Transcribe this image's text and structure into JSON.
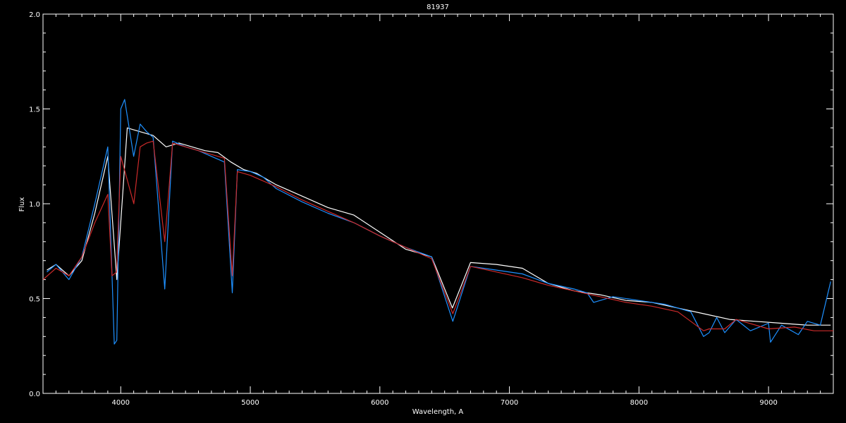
{
  "chart_data": {
    "type": "line",
    "title": "81937",
    "xlabel": "Wavelength, A",
    "ylabel": "Flux",
    "xlim": [
      3400,
      9500
    ],
    "ylim": [
      0.0,
      2.0
    ],
    "x_ticks": [
      4000,
      5000,
      6000,
      7000,
      8000,
      9000
    ],
    "x_tick_labels": [
      "4000",
      "5000",
      "6000",
      "7000",
      "8000",
      "9000"
    ],
    "y_ticks": [
      0.0,
      0.5,
      1.0,
      1.5,
      2.0
    ],
    "y_tick_labels": [
      "0.0",
      "0.5",
      "1.0",
      "1.5",
      "2.0"
    ],
    "grid": false,
    "series": [
      {
        "color": "#ffffff",
        "x": [
          3430,
          3500,
          3600,
          3700,
          3800,
          3900,
          3970,
          4050,
          4150,
          4250,
          4350,
          4450,
          4550,
          4650,
          4750,
          4850,
          4950,
          5050,
          5200,
          5400,
          5600,
          5800,
          6000,
          6200,
          6400,
          6560,
          6700,
          6900,
          7100,
          7300,
          7500,
          7700,
          7900,
          8100,
          8300,
          8500,
          8700,
          8900,
          9100,
          9300,
          9480
        ],
        "y": [
          0.65,
          0.68,
          0.62,
          0.7,
          0.95,
          1.25,
          0.6,
          1.4,
          1.38,
          1.36,
          1.3,
          1.32,
          1.3,
          1.28,
          1.27,
          1.22,
          1.18,
          1.16,
          1.1,
          1.04,
          0.98,
          0.94,
          0.85,
          0.76,
          0.72,
          0.45,
          0.69,
          0.68,
          0.66,
          0.58,
          0.54,
          0.52,
          0.49,
          0.48,
          0.45,
          0.42,
          0.39,
          0.38,
          0.37,
          0.36,
          0.36
        ]
      },
      {
        "color": "#1e90ff",
        "x": [
          3430,
          3500,
          3600,
          3700,
          3800,
          3900,
          3950,
          3970,
          4000,
          4030,
          4100,
          4150,
          4200,
          4250,
          4340,
          4400,
          4500,
          4600,
          4700,
          4800,
          4861,
          4900,
          5000,
          5100,
          5200,
          5400,
          5600,
          5800,
          6000,
          6200,
          6400,
          6563,
          6700,
          6900,
          7100,
          7300,
          7500,
          7600,
          7650,
          7800,
          8000,
          8200,
          8400,
          8498,
          8542,
          8600,
          8662,
          8750,
          8860,
          9000,
          9015,
          9100,
          9230,
          9300,
          9400,
          9480
        ],
        "y": [
          0.64,
          0.68,
          0.6,
          0.72,
          1.0,
          1.3,
          0.26,
          0.28,
          1.5,
          1.55,
          1.25,
          1.42,
          1.38,
          1.35,
          0.55,
          1.33,
          1.3,
          1.28,
          1.25,
          1.22,
          0.53,
          1.18,
          1.17,
          1.14,
          1.08,
          1.01,
          0.95,
          0.9,
          0.83,
          0.77,
          0.72,
          0.38,
          0.67,
          0.65,
          0.63,
          0.58,
          0.55,
          0.53,
          0.48,
          0.51,
          0.49,
          0.47,
          0.43,
          0.3,
          0.32,
          0.4,
          0.32,
          0.39,
          0.33,
          0.37,
          0.27,
          0.36,
          0.31,
          0.38,
          0.36,
          0.59
        ]
      },
      {
        "color": "#cc2a2a",
        "x": [
          3400,
          3500,
          3600,
          3700,
          3800,
          3900,
          3933,
          3968,
          4000,
          4101,
          4150,
          4200,
          4250,
          4340,
          4400,
          4500,
          4600,
          4700,
          4800,
          4861,
          4900,
          5000,
          5200,
          5400,
          5600,
          5800,
          6000,
          6200,
          6400,
          6563,
          6700,
          6900,
          7100,
          7300,
          7500,
          7700,
          7900,
          8100,
          8300,
          8498,
          8542,
          8662,
          8750,
          9000,
          9200,
          9350,
          9500
        ],
        "y": [
          0.6,
          0.66,
          0.62,
          0.72,
          0.9,
          1.05,
          0.62,
          0.64,
          1.25,
          1.0,
          1.3,
          1.32,
          1.33,
          0.8,
          1.32,
          1.3,
          1.28,
          1.26,
          1.24,
          0.62,
          1.17,
          1.15,
          1.09,
          1.02,
          0.96,
          0.9,
          0.83,
          0.77,
          0.71,
          0.42,
          0.67,
          0.64,
          0.61,
          0.57,
          0.54,
          0.51,
          0.48,
          0.46,
          0.43,
          0.33,
          0.34,
          0.34,
          0.39,
          0.34,
          0.35,
          0.33,
          0.33
        ]
      }
    ]
  }
}
